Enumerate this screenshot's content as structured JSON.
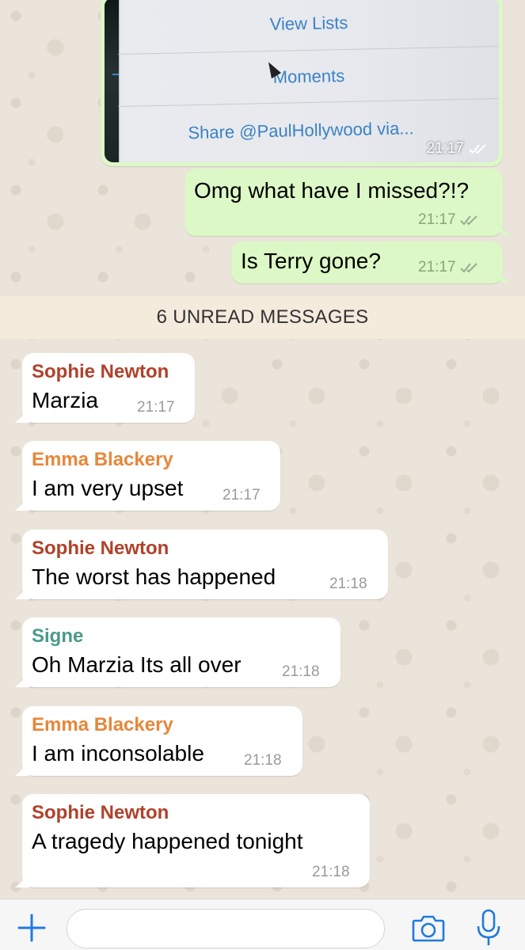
{
  "colors": {
    "outgoing_bubble": "#dcf8c6",
    "incoming_bubble": "#ffffff",
    "accent_blue": "#1f7ae0",
    "sender_sophie": "#b0412a",
    "sender_emma": "#e6873a",
    "sender_signe": "#4a9a8a"
  },
  "image_message": {
    "lines": [
      "View Lists",
      "Moments",
      "Share @PaulHollywood via..."
    ],
    "time": "21:17"
  },
  "outgoing": [
    {
      "text": "Omg what have I missed?!?",
      "time": "21:17"
    },
    {
      "text": "Is Terry gone?",
      "time": "21:17"
    }
  ],
  "unread_banner": "6 UNREAD MESSAGES",
  "incoming": [
    {
      "sender": "Sophie Newton",
      "text": "Marzia",
      "time": "21:17"
    },
    {
      "sender": "Emma Blackery",
      "text": "I am very upset",
      "time": "21:17"
    },
    {
      "sender": "Sophie Newton",
      "text": "The worst has happened",
      "time": "21:18"
    },
    {
      "sender": "Signe",
      "text": "Oh Marzia Its all over",
      "time": "21:18"
    },
    {
      "sender": "Emma Blackery",
      "text": "I am inconsolable",
      "time": "21:18"
    },
    {
      "sender": "Sophie Newton",
      "text": "A tragedy happened tonight",
      "time": "21:18"
    }
  ],
  "input_bar": {
    "placeholder": "",
    "icons": [
      "plus-icon",
      "camera-icon",
      "microphone-icon"
    ]
  }
}
